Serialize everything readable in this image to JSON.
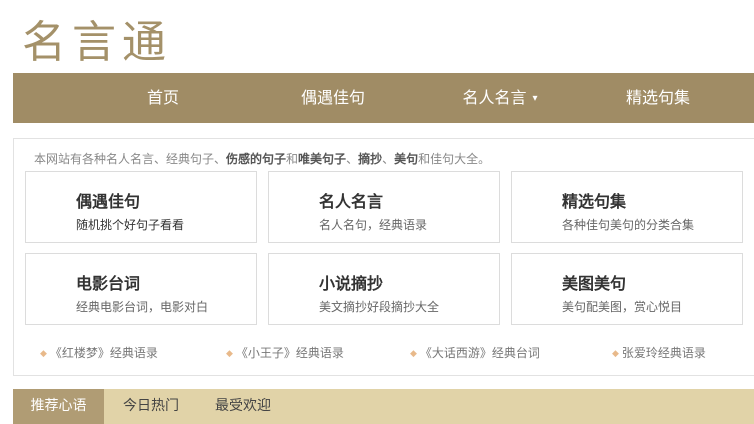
{
  "site": {
    "logo": "名言通"
  },
  "nav": {
    "items": [
      {
        "label": "首页"
      },
      {
        "label": "偶遇佳句"
      },
      {
        "label": "名人名言",
        "caret": "▾"
      },
      {
        "label": "精选句集"
      }
    ]
  },
  "intro": {
    "p1": "本网站有各种名人名言、经典句子、",
    "b1": "伤感的句子",
    "p2": "和",
    "b2": "唯美句子",
    "p3": "、",
    "b3": "摘抄",
    "p4": "、",
    "b4": "美句",
    "p5": "和佳句大全。"
  },
  "cards": [
    {
      "title": "偶遇佳句",
      "desc": "随机挑个好句子看看"
    },
    {
      "title": "名人名言",
      "desc": "名人名句，经典语录"
    },
    {
      "title": "精选句集",
      "desc": "各种佳句美句的分类合集"
    },
    {
      "title": "电影台词",
      "desc": "经典电影台词，电影对白"
    },
    {
      "title": "小说摘抄",
      "desc": "美文摘抄好段摘抄大全"
    },
    {
      "title": "美图美句",
      "desc": "美句配美图，赏心悦目"
    }
  ],
  "book_links": [
    {
      "label": "《红楼梦》经典语录"
    },
    {
      "label": "《小王子》经典语录"
    },
    {
      "label": "《大话西游》经典台词"
    },
    {
      "label": "张爱玲经典语录"
    }
  ],
  "tabs": [
    {
      "label": "推荐心语",
      "active": true
    },
    {
      "label": "今日热门"
    },
    {
      "label": "最受欢迎"
    }
  ],
  "colors": {
    "brand": "#a08c65",
    "logo": "#a49169",
    "tabbar": "#e1d3a8",
    "tab_active": "#b09c74",
    "bullet": "#e8b98a"
  }
}
